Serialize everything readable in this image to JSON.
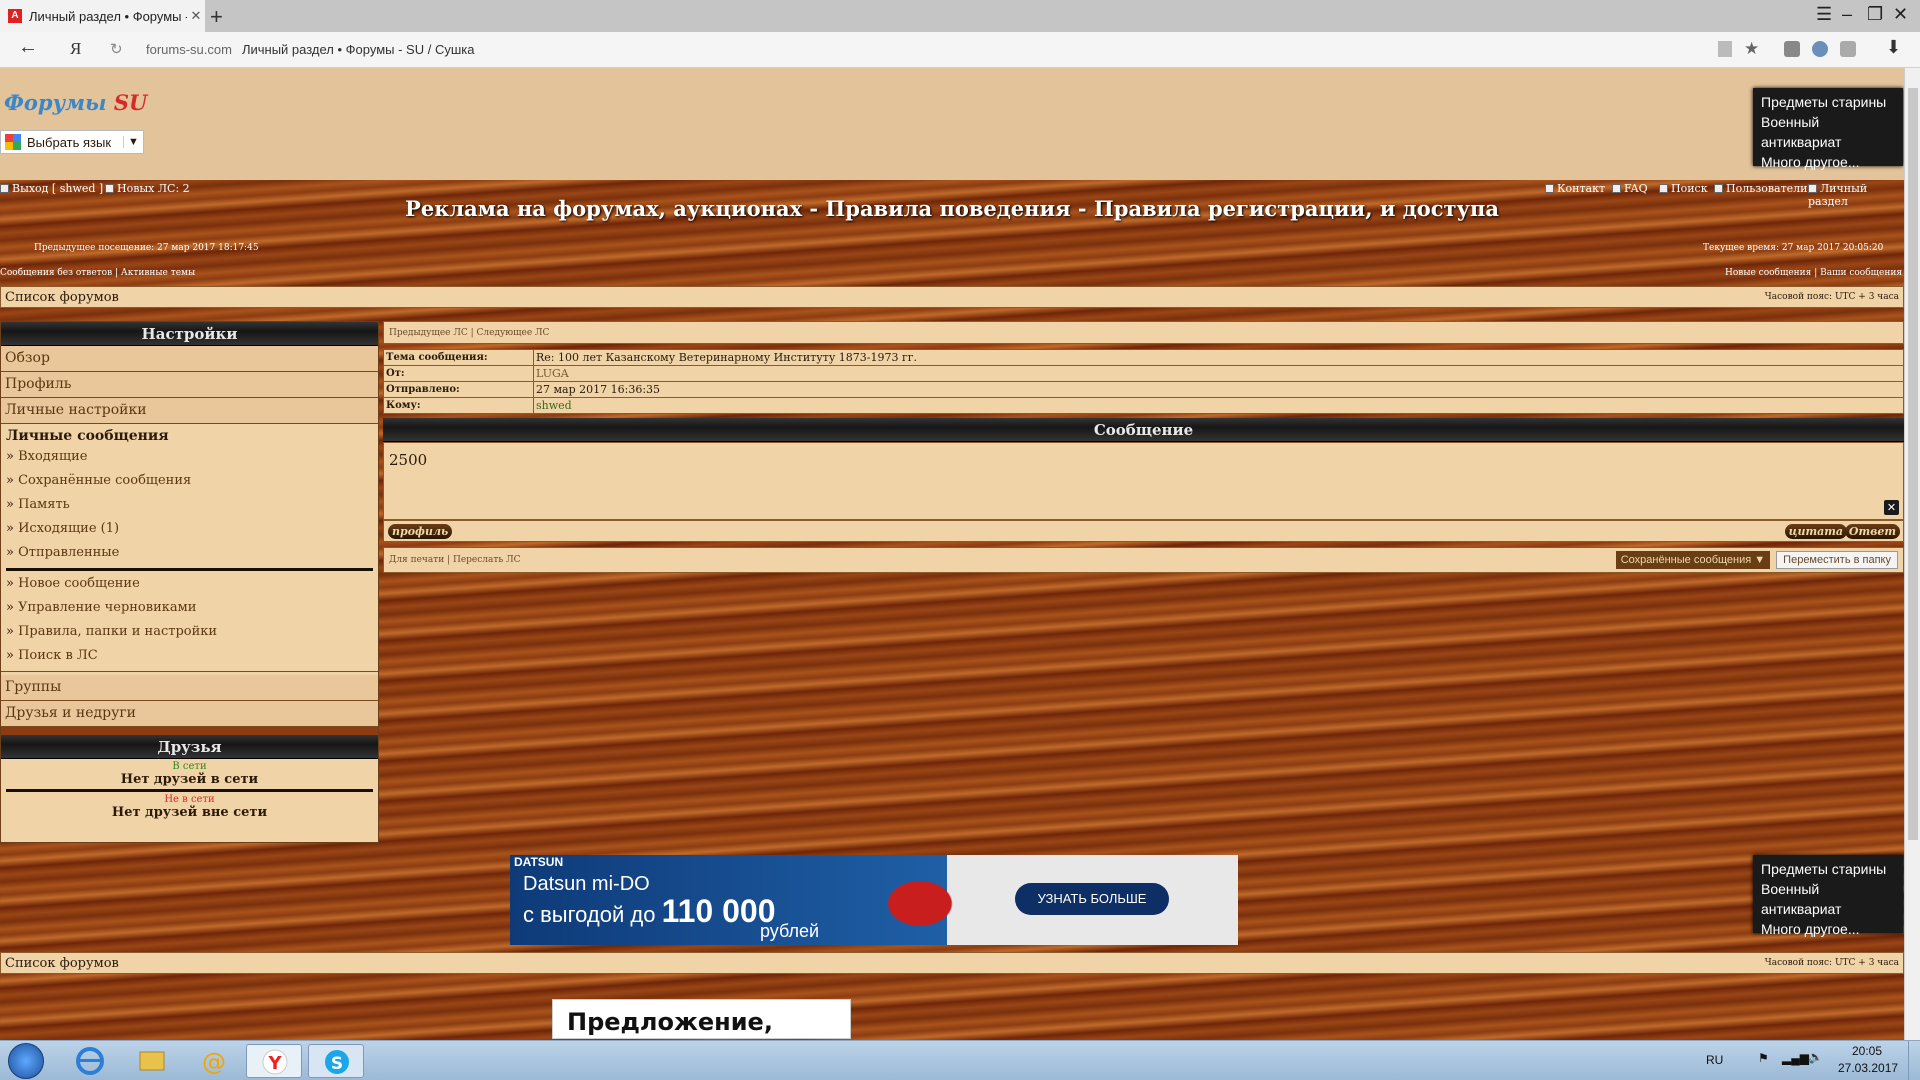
{
  "browser": {
    "tab_title": "Личный раздел • Форумы - SU / Сушка",
    "tab_favicon": "A",
    "new_tab": "+",
    "addr_domain": "forums-su.com",
    "addr_title": "Личный раздел • Форумы - SU / Сушка",
    "yandex_logo": "Я"
  },
  "header": {
    "logo_part1": "Форумы ",
    "logo_part2": "SU",
    "lang_select": "Выбрать язык"
  },
  "side_ad": {
    "lines": [
      "Предметы старины",
      "Военный антиквариат",
      "Много другое..."
    ]
  },
  "topnav": {
    "logout": "Выход [ shwed ]",
    "new_pm": "Новых ЛС: 2",
    "contact": "Контакт",
    "faq": "FAQ",
    "search": "Поиск",
    "users": "Пользователи",
    "personal": "Личный раздел"
  },
  "page_title": "Реклама на форумах, аукционах - Правила поведения - Правила регистрации, и доступа",
  "last_visit": "Предыдущее посещение: 27 мар 2017 18:17:45",
  "current_time": "Текущее время: 27 мар 2017 20:05:20",
  "links": {
    "unanswered": "Сообщения без ответов",
    "active": "Активные темы",
    "new_posts": "Новые сообщения",
    "your_posts": "Ваши сообщения"
  },
  "forum_list": "Список форумов",
  "timezone": "Часовой пояс: UTC + 3 часа",
  "settings": {
    "heading": "Настройки",
    "overview": "Обзор",
    "profile": "Профиль",
    "personal_settings": "Личные настройки",
    "pm_heading": "Личные сообщения",
    "inbox": "Входящие",
    "saved": "Сохранённые сообщения",
    "memory": "Память",
    "outbox": "Исходящие (1)",
    "sent": "Отправленные",
    "new_msg": "Новое сообщение",
    "drafts": "Управление черновиками",
    "rules": "Правила, папки и настройки",
    "pm_search": "Поиск в ЛС",
    "groups": "Группы",
    "friends_foes": "Друзья и недруги"
  },
  "friends": {
    "heading": "Друзья",
    "online_label": "В сети",
    "online_none": "Нет друзей в сети",
    "offline_label": "Не в сети",
    "offline_none": "Нет друзей вне сети"
  },
  "message": {
    "prev": "Предыдущее ЛС",
    "next": "Следующее ЛС",
    "subject_label": "Тема сообщения:",
    "subject": "Re: 100 лет Казанскому Ветеринарному Институту 1873-1973 гг.",
    "from_label": "От:",
    "from": "LUGA",
    "sent_label": "Отправлено:",
    "sent": "27 мар 2017 16:36:35",
    "to_label": "Кому:",
    "to": "shwed",
    "body_heading": "Сообщение",
    "body": "2500",
    "profile_btn": "профиль",
    "quote_btn": "цитата",
    "reply_btn": "Ответ",
    "print": "Для печати",
    "forward": "Переслать ЛС",
    "folder": "Сохранённые сообщения",
    "move": "Переместить в папку"
  },
  "banner": {
    "brand": "DATSUN",
    "line1": "Datsun mi-DO",
    "line2": "с выгодой до",
    "amount": "110 000",
    "currency": "рублей",
    "cta": "УЗНАТЬ БОЛЬШЕ"
  },
  "bottom_ad": "Предложение,",
  "taskbar": {
    "lang": "RU",
    "time": "20:05",
    "date": "27.03.2017"
  }
}
